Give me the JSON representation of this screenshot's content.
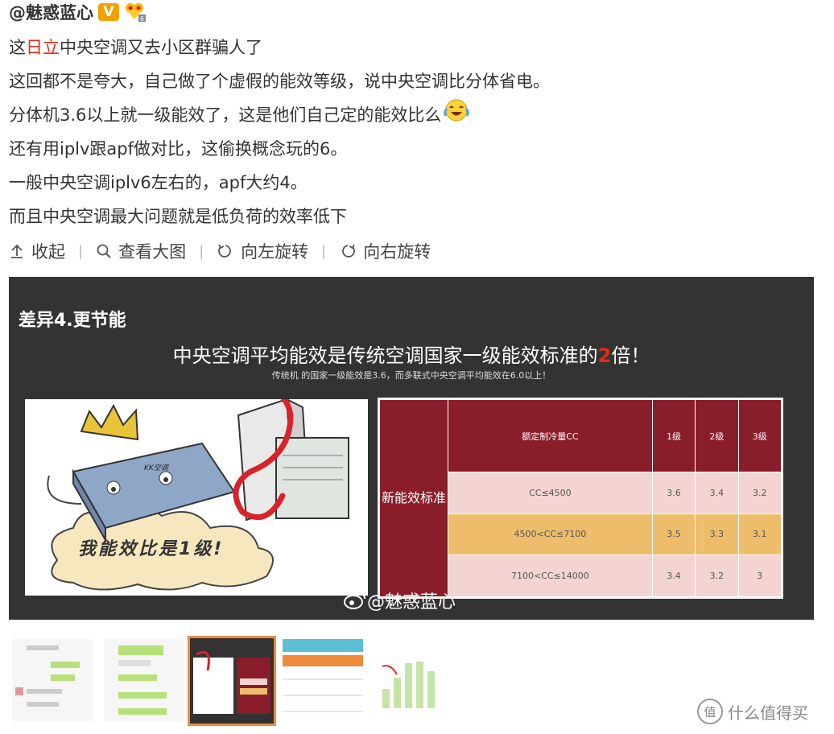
{
  "post": {
    "author": "@魅惑蓝心",
    "vip_badge": "V",
    "lines": [
      "中央空调又去小区群骗人了",
      "这回都不是夸大，自己做了个虚假的能效等级，说中央空调比分体省电。",
      "分体机3.6以上就一级能效了，这是他们自己定的能效比么",
      "还有用iplv跟apf做对比，这偷换概念玩的6。",
      "一般中央空调iplv6左右的，apf大约4。",
      "而且中央空调最大问题就是低负荷的效率低下"
    ],
    "line1_prefix": "这",
    "line1_brand": "日立",
    "accent_color": "#e8291a"
  },
  "actions": {
    "collapse": "收起",
    "view_large": "查看大图",
    "rotate_left": "向左旋转",
    "rotate_right": "向右旋转"
  },
  "image": {
    "section_title": "差异4.更节能",
    "headline_a": "中央空调平均能效是传统空调国家一级能效标准的",
    "headline_num": "2",
    "headline_b": "倍！",
    "subline": "传统机  的国家一级能效是3.6，而多联式中央空调平均能效在6.0以上！",
    "cartoon_caption": "我能效比是1级!",
    "cartoon_label": "KK空调",
    "table": {
      "side_label": "新能效标准",
      "headers": [
        "额定制冷量CC",
        "1级",
        "2级",
        "3级"
      ],
      "rows": [
        [
          "CC≤4500",
          "3.6",
          "3.4",
          "3.2"
        ],
        [
          "4500<CC≤7100",
          "3.5",
          "3.3",
          "3.1"
        ],
        [
          "7100<CC≤14000",
          "3.4",
          "3.2",
          "3"
        ]
      ]
    },
    "watermark": "@魅惑蓝心"
  },
  "thumbs": [
    {
      "name": "chat-1"
    },
    {
      "name": "chat-2"
    },
    {
      "name": "energy-image",
      "active": true
    },
    {
      "name": "table-image"
    },
    {
      "name": "bar-chart-image"
    }
  ],
  "footer": {
    "site": "什么值得买",
    "icon": "值"
  }
}
